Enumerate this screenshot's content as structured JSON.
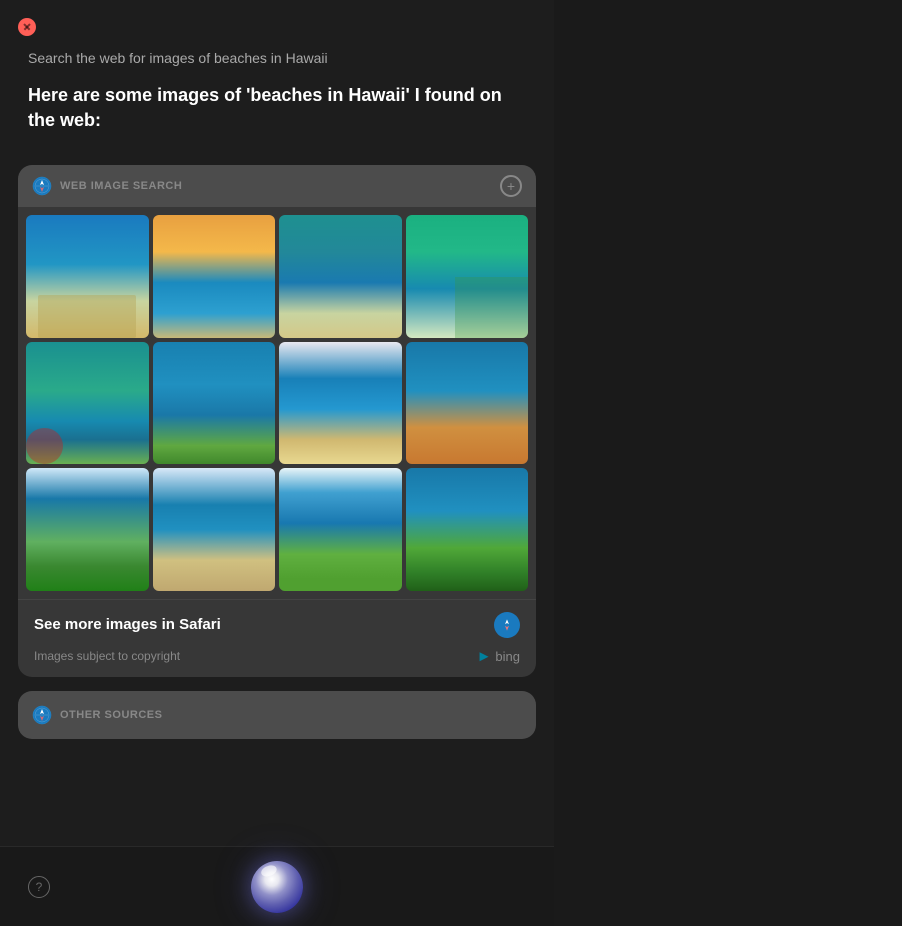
{
  "window": {
    "title": "Siri",
    "close_label": "close"
  },
  "query": {
    "text": "Search the web for images of beaches in Hawaii"
  },
  "result_heading": "Here are some images of 'beaches in Hawaii' I found on the web:",
  "web_image_search": {
    "section_title": "WEB IMAGE SEARCH",
    "plus_label": "+",
    "images": [
      {
        "id": 1,
        "alt": "Beach with palm trees Hawaii"
      },
      {
        "id": 2,
        "alt": "Sunset beach Hawaii"
      },
      {
        "id": 3,
        "alt": "Tropical island Hawaii"
      },
      {
        "id": 4,
        "alt": "Green palm beach Hawaii"
      },
      {
        "id": 5,
        "alt": "Turquoise water Hawaii lighthouse"
      },
      {
        "id": 6,
        "alt": "Blue bay palm trees Hawaii"
      },
      {
        "id": 7,
        "alt": "Waves and palm trees Hawaii"
      },
      {
        "id": 8,
        "alt": "Sandy beach orange sky Hawaii"
      },
      {
        "id": 9,
        "alt": "Mountain beach resort Hawaii"
      },
      {
        "id": 10,
        "alt": "Sandy cove Hawaii"
      },
      {
        "id": 11,
        "alt": "Tropical palms beach Hawaii"
      },
      {
        "id": 12,
        "alt": "Deep blue bay Hawaii"
      }
    ],
    "see_more_label": "See more images in Safari",
    "copyright_label": "Images subject to copyright",
    "bing_label": "bing"
  },
  "other_sources": {
    "section_title": "OTHER SOURCES"
  },
  "bottom_bar": {
    "help_label": "?",
    "siri_label": "Siri"
  }
}
